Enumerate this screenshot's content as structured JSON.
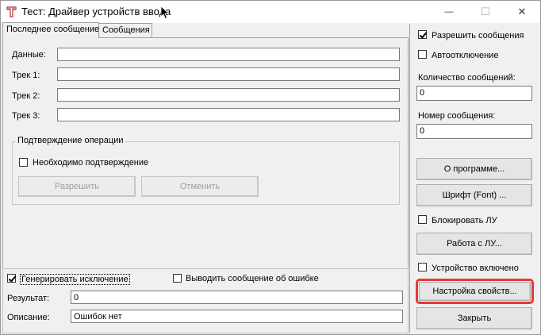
{
  "window": {
    "title": "Тест: Драйвер устройств ввода",
    "minimize_glyph": "—",
    "maximize_glyph": "☐",
    "close_glyph": "✕"
  },
  "tabs": [
    {
      "label": "Последнее сообщение",
      "active": true
    },
    {
      "label": "Сообщения",
      "active": false
    }
  ],
  "last_message": {
    "data_label": "Данные:",
    "data_value": "",
    "track1_label": "Трек 1:",
    "track1_value": "",
    "track2_label": "Трек 2:",
    "track2_value": "",
    "track3_label": "Трек 3:",
    "track3_value": ""
  },
  "confirm_group": {
    "title": "Подтверждение операции",
    "need_confirm_label": "Необходимо подтверждение",
    "need_confirm_checked": false,
    "allow_label": "Разрешить",
    "cancel_label": "Отменить"
  },
  "bottom": {
    "generate_exception_label": "Генерировать исключение",
    "generate_exception_checked": true,
    "show_error_label": "Выводить сообщение об ошибке",
    "show_error_checked": false,
    "result_label": "Результат:",
    "result_value": "0",
    "description_label": "Описание:",
    "description_value": "Ошибок нет"
  },
  "right_panel": {
    "enable_messages_label": "Разрешить сообщения",
    "enable_messages_checked": true,
    "auto_disable_label": "Автоотключение",
    "auto_disable_checked": false,
    "message_count_label": "Количество сообщений:",
    "message_count_value": "0",
    "message_number_label": "Номер сообщения:",
    "message_number_value": "0",
    "about_label": "О программе...",
    "font_label": "Шрифт (Font) ...",
    "lock_lu_label": "Блокировать ЛУ",
    "lock_lu_checked": false,
    "lu_work_label": "Работа с ЛУ...",
    "device_enabled_label": "Устройство включено",
    "device_enabled_checked": false,
    "properties_label": "Настройка свойств...",
    "close_label": "Закрыть"
  },
  "colors": {
    "highlight": "#e53935",
    "background": "#f0f0f0"
  }
}
